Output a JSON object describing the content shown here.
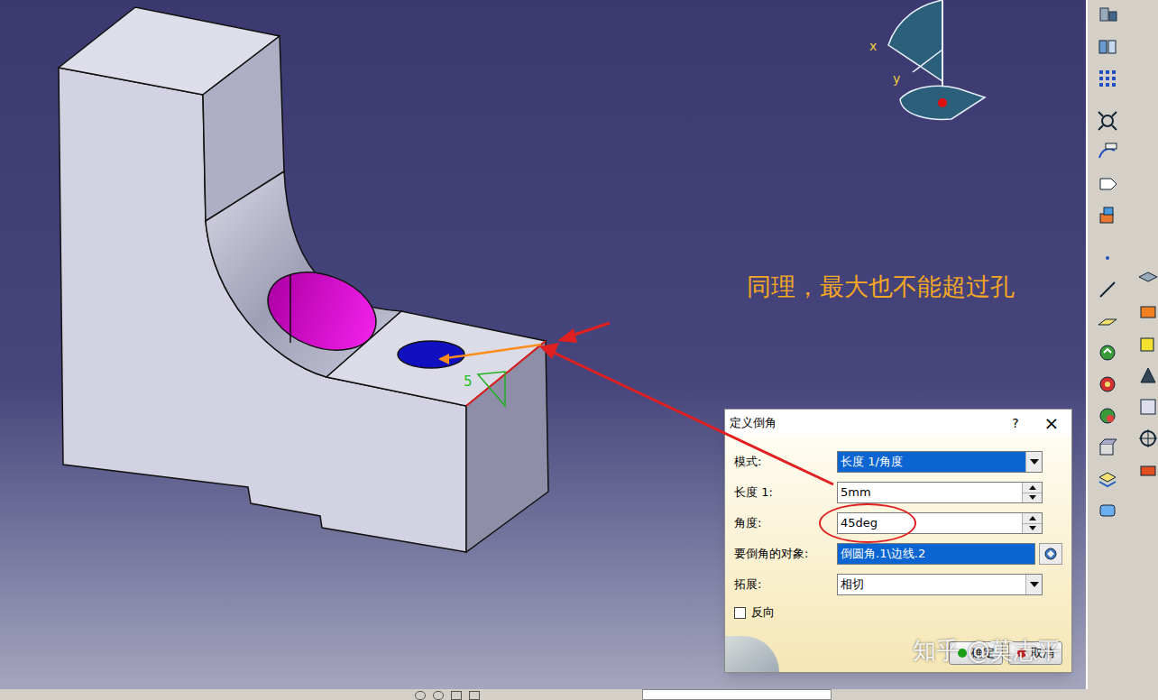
{
  "viewport": {
    "dimension_label": "5",
    "axes": [
      "x",
      "y"
    ]
  },
  "annotation": "同理，最大也不能超过孔",
  "dialog": {
    "title": "定义倒角",
    "help": "?",
    "close": "×",
    "fields": [
      {
        "label": "模式:",
        "value": "长度 1/角度",
        "kind": "dropdown",
        "highlighted": true,
        "circled": false
      },
      {
        "label": "长度 1:",
        "value": "5mm",
        "kind": "spinner",
        "highlighted": false,
        "circled": false
      },
      {
        "label": "角度:",
        "value": "45deg",
        "kind": "spinner",
        "highlighted": false,
        "circled": true
      },
      {
        "label": "要倒角的对象:",
        "value": "倒圆角.1\\边线.2",
        "kind": "selector",
        "highlighted": true,
        "circled": false
      },
      {
        "label": "拓展:",
        "value": "相切",
        "kind": "dropdown",
        "highlighted": false,
        "circled": false
      }
    ],
    "reverse": {
      "label": "反向",
      "checked": false
    },
    "buttons": [
      "确定",
      "取消"
    ]
  },
  "watermark": "知乎 @莫志平"
}
